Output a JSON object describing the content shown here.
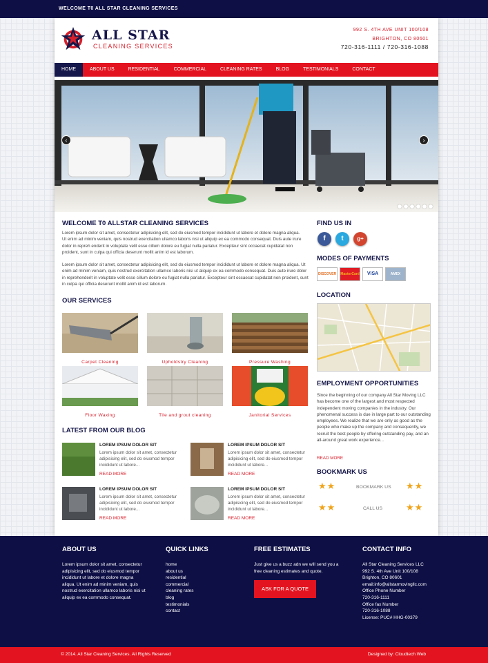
{
  "topbar": {
    "text": "WELCOME T0 ALL STAR CLEANING SERVICES"
  },
  "header": {
    "logo_title": "ALL STAR",
    "logo_subtitle": "CLEANING SERVICES",
    "address_line1": "992 S. 4TH AVE UNIT 100/108",
    "address_line2": "BRIGHTON, CO 80601",
    "phones": "720-316-1111 / 720-316-1088"
  },
  "nav": [
    "HOME",
    "ABOUT US",
    "RESIDENTIAL",
    "COMMERCIAL",
    "CLEANING RATES",
    "BLOG",
    "TESTIMONIALS",
    "CONTACT"
  ],
  "slider": {
    "prev": "‹",
    "next": "›"
  },
  "welcome": {
    "title": "WELCOME T0 ALLSTAR CLEANING SERVICES",
    "p1": "Lorem ipsum dolor sit amet, consectetur adipisicing elit, sed do eiusmod tempor incididunt ut labore et dolore magna aliqua. Ut enim ad minim veniam, quis nostrud exercitation ullamco laboris nisi ut aliquip ex ea commodo consequat. Duis aute irure dolor in repreh enderit in voluptate velit esse cillum dolore eu fugiat nulla pariatur. Excepteur sint occaecat cupidatat non proident, sunt in culpa qui officia deserunt mollit anim id est laborum.",
    "p2": "Lorem ipsum dolor sit amet, consectetur adipisicing elit, sed do eiusmod tempor incididunt ut labore et dolore magna aliqua. Ut enim ad minim veniam, quis nostrud exercitation ullamco laboris nisi ut aliquip ex ea commodo consequat. Duis aute irure dolor in reprehenderit in voluptate velit esse cillum dolore eu fugiat nulla pariatur. Excepteur sint occaecat cupidatat non proident, sunt in culpa qui officia deserunt mollit anim id est laborum."
  },
  "services": {
    "title": "OUR SERVICES",
    "items": [
      "Carpet Cleaning",
      "Upholdstry Cleaning",
      "Pressure Washing",
      "Floor Waxing",
      "Tile and grout cleaning",
      "Janitorial Services"
    ]
  },
  "blog": {
    "title": "LATEST FROM OUR BLOG",
    "post_title": "LOREM IPSUM DOLOR SIT",
    "post_text": "Lorem ipsum dolor sit amet, consectetur adipisicing elit, sed do eiusmod tempor incididunt ut labore...",
    "read_more": "READ MORE"
  },
  "sidebar": {
    "find_us": "FIND US IN",
    "social": [
      "f",
      "t",
      "g+"
    ],
    "payments_title": "MODES OF PAYMENTS",
    "cards": [
      "DISCOVER",
      "MasterCard",
      "VISA",
      "AMEX"
    ],
    "location_title": "LOCATION",
    "employment_title": "EMPLOYMENT OPPORTUNITIES",
    "employment_text": "Since the beginning of our company All Star Moving LLC has become one of the largest and most respected independent moving companies in the industry. Our phenomenal success is due in large part to our outstanding employees. We realize that we are only as good as the people who make up the company and consequently, we recruit the best people by offering outstanding pay, and an all-around great work experience...",
    "employment_more": "READ MORE",
    "bookmark_title": "BOOKMARK US",
    "bookmark_label": "BOOKMARK US",
    "call_label": "CALL US",
    "stars": "★★"
  },
  "footer": {
    "about_title": "ABOUT US",
    "about_text": "Lorem ipsum dolor sit amet, consectetur adipisicing elit, sed do eiusmod tempor incididunt ut labore et dolore magna aliqua. Ut enim ad minim veniam, quis nostrud exercitation ullamco laboris nisi ut aliquip ex ea commodo consequat.",
    "links_title": "QUICK LINKS",
    "links": [
      "home",
      "about us",
      "residential",
      "commercial",
      "cleaning rates",
      "blog",
      "testimonials",
      "contact"
    ],
    "estimates_title": "FREE ESTIMATES",
    "estimates_text": "Just give us a buzz adn we will send you a free cleaning estimates and quote.",
    "quote_button": "ASK FOR A QUOTE",
    "contact_title": "CONTACT  INFO",
    "contact_lines": [
      "All Star Cleaning Services LLC",
      "992 S. 4th Ave Unit 100/108",
      "Brighton, CO 80601",
      "email:info@allstarmovingllc.com",
      "Office Phone Number",
      "720-316-1111",
      "Office fax Number",
      "720-316-1088",
      "License: PUC# HHG-00379"
    ]
  },
  "bottombar": {
    "copyright": "© 2014. All Star Cleaning Services. All Rights Reserved",
    "designed_by": "Designed by: Cloudtech Web"
  },
  "colors": {
    "navy": "#16174a",
    "red": "#e3141f",
    "star": "#f0a41b"
  }
}
